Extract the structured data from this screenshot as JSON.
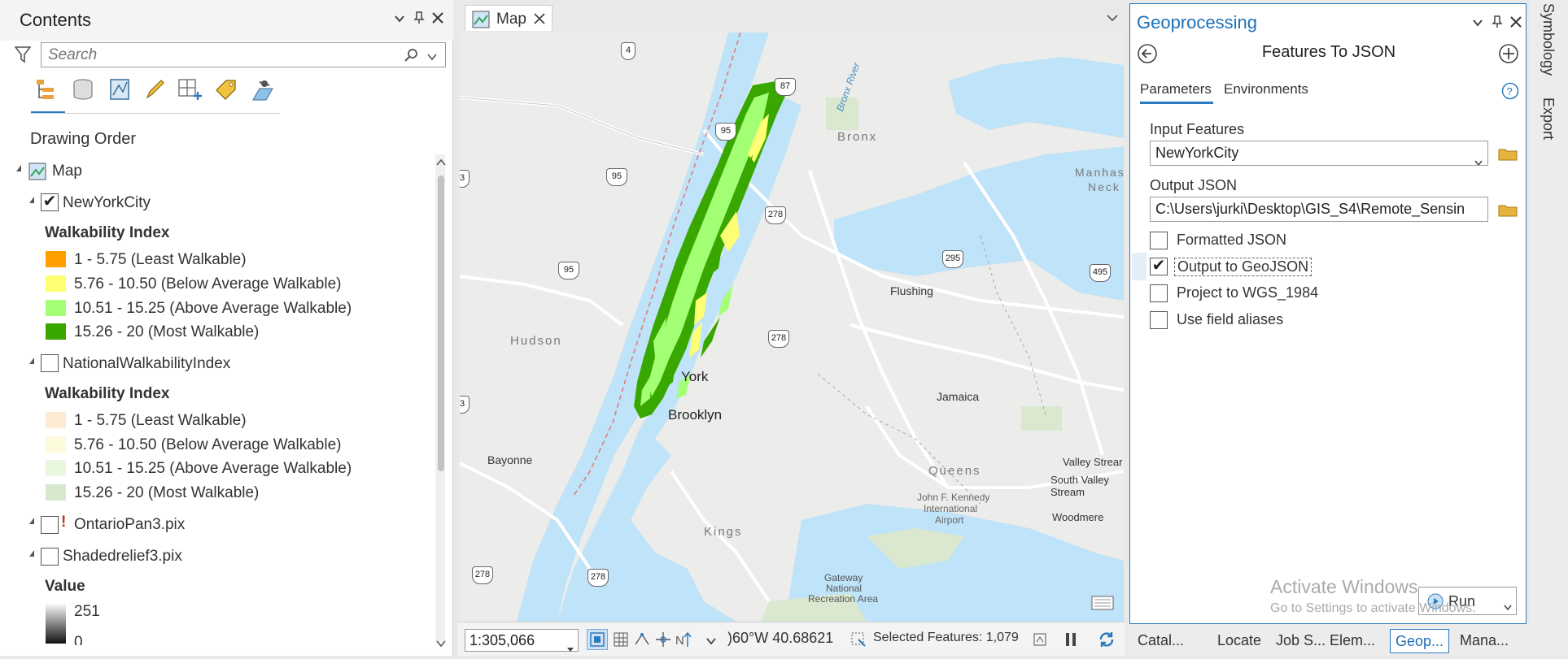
{
  "contents": {
    "title": "Contents",
    "search_placeholder": "Search",
    "drawing_order": "Drawing Order",
    "map_label": "Map",
    "layers": [
      {
        "name": "NewYorkCity",
        "checked": true,
        "legend_title": "Walkability Index",
        "classes": [
          {
            "label": "1 - 5.75 (Least Walkable)",
            "color": "#ff9f00"
          },
          {
            "label": "5.76 - 10.50 (Below Average Walkable)",
            "color": "#ffff73"
          },
          {
            "label": "10.51 - 15.25 (Above Average Walkable)",
            "color": "#a3ff73"
          },
          {
            "label": "15.26 - 20 (Most Walkable)",
            "color": "#38a800"
          }
        ]
      },
      {
        "name": "NationalWalkabilityIndex",
        "checked": false,
        "legend_title": "Walkability Index",
        "classes": [
          {
            "label": "1 - 5.75 (Least Walkable)",
            "color": "#fdebd3"
          },
          {
            "label": "5.76 - 10.50 (Below Average Walkable)",
            "color": "#fbfbdc"
          },
          {
            "label": "10.51 - 15.25 (Above Average Walkable)",
            "color": "#e8f8df"
          },
          {
            "label": "15.26 - 20 (Most Walkable)",
            "color": "#d6e9cc"
          }
        ]
      },
      {
        "name": "OntarioPan3.pix",
        "checked": false,
        "warning": "!"
      },
      {
        "name": "Shadedrelief3.pix",
        "checked": false,
        "legend_title": "Value",
        "max": "251",
        "min": "0"
      }
    ]
  },
  "map": {
    "tab_label": "Map",
    "places": {
      "bronx": "Bronx",
      "manhattan": "Manhas\nNeck",
      "manhattan_l1": "Manhas",
      "manhattan_l2": "Neck",
      "flushing": "Flushing",
      "hudson": "Hudson",
      "york": "York",
      "brooklyn": "Brooklyn",
      "jamaica": "Jamaica",
      "bayonne": "Bayonne",
      "queens": "Queens",
      "jfk_1": "John F. Kennedy",
      "jfk_2": "International",
      "jfk_3": "Airport",
      "valley_stream": "Valley Strear",
      "south_valley_1": "South Valley",
      "south_valley_2": "Stream",
      "woodmere": "Woodmere",
      "kings": "Kings",
      "gateway_1": "Gateway",
      "gateway_2": "National",
      "gateway_3": "Recreation Area",
      "bronx_river": "Bronx River"
    },
    "shields": [
      "4",
      "87",
      "95",
      "95",
      "278",
      "95",
      "295",
      "495",
      "278",
      "3",
      "3",
      "278",
      "278"
    ],
    "scale": "1:305,066",
    "coords": ")60°W 40.68621",
    "selected_features": "Selected Features: 1,079"
  },
  "geoprocessing": {
    "title": "Geoprocessing",
    "tool_title": "Features To JSON",
    "tabs": [
      "Parameters",
      "Environments"
    ],
    "input_label": "Input Features",
    "input_value": "NewYorkCity",
    "output_label": "Output JSON",
    "output_value": "C:\\Users\\jurki\\Desktop\\GIS_S4\\Remote_Sensin",
    "options": [
      {
        "label": "Formatted JSON",
        "checked": false
      },
      {
        "label": "Output to GeoJSON",
        "checked": true
      },
      {
        "label": "Project to WGS_1984",
        "checked": false
      },
      {
        "label": "Use field aliases",
        "checked": false
      }
    ],
    "watermark_1": "Activate Windows",
    "watermark_2": "Go to Settings to activate Windows.",
    "run_label": "Run"
  },
  "side_tabs": [
    "Symbology",
    "Export"
  ],
  "bottom_tabs": [
    "Catal...",
    "Locate",
    "Job S...",
    "Elem...",
    "Geop...",
    "Mana..."
  ]
}
